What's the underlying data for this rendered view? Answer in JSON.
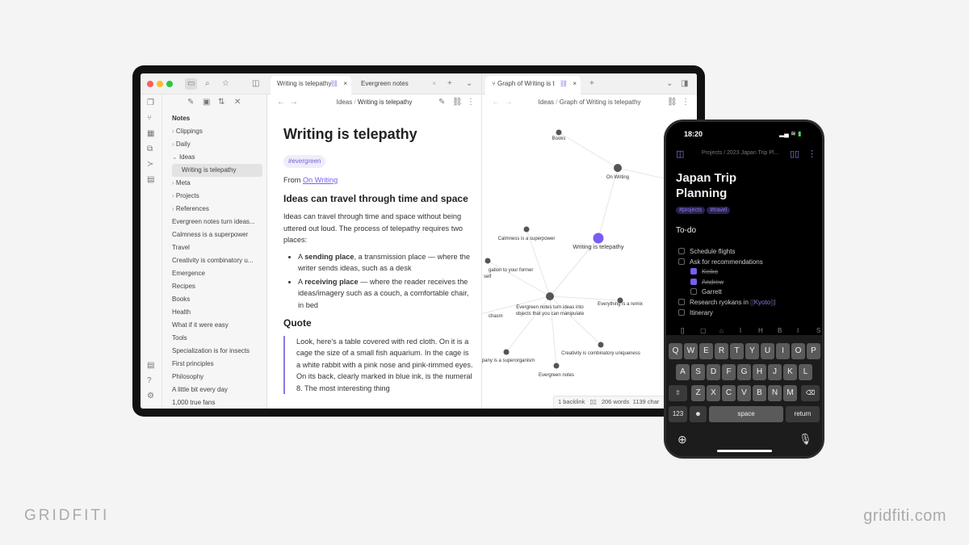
{
  "colors": {
    "accent": "#7a5cf0",
    "background": "#f4f4f4"
  },
  "app": {
    "left_tabs": [
      {
        "label": "Writing is telepathy",
        "active": true
      },
      {
        "label": "Evergreen notes",
        "active": false
      }
    ],
    "right_tabs": [
      {
        "label": "Graph of Writing is t",
        "active": true
      }
    ],
    "ribbon_icons": [
      "files-icon",
      "graph-icon",
      "calendar-icon",
      "copy-icon",
      "terminal-icon",
      "canvas-icon",
      "help-doc-icon",
      "help-icon",
      "settings-icon"
    ],
    "explorer": {
      "header": "Notes",
      "folders": [
        {
          "label": "Clippings",
          "open": false
        },
        {
          "label": "Daily",
          "open": false
        },
        {
          "label": "Ideas",
          "open": true
        }
      ],
      "selected": "Writing is telepathy",
      "more_folders": [
        "Meta",
        "Projects",
        "References"
      ],
      "files": [
        "Evergreen notes turn ideas...",
        "Calmness is a superpower",
        "Travel",
        "Creativity is combinatory u...",
        "Emergence",
        "Recipes",
        "Books",
        "Health",
        "What if it were easy",
        "Tools",
        "Specialization is for insects",
        "First principles",
        "Philosophy",
        "A little bit every day",
        "1,000 true fans"
      ]
    },
    "editor": {
      "breadcrumb": {
        "folder": "Ideas",
        "sep": "/",
        "note": "Writing is telepathy"
      },
      "title": "Writing is telepathy",
      "tag": "#evergreen",
      "from_label": "From ",
      "from_link": "On Writing",
      "h2": "Ideas can travel through time and space",
      "para": "Ideas can travel through time and space without being uttered out loud. The process of telepathy requires two places:",
      "bullets": [
        {
          "pre": "A ",
          "bold": "sending place",
          "post": ", a transmission place — where the writer sends ideas, such as a desk"
        },
        {
          "pre": "A ",
          "bold": "receiving place",
          "post": " — where the reader receives the ideas/imagery such as a couch, a comfortable chair, in bed"
        }
      ],
      "quote_heading": "Quote",
      "quote": "Look, here's a table covered with red cloth. On it is a cage the size of a small fish aquarium. In the cage is a white rabbit with a pink nose and pink-rimmed eyes. On its back, clearly marked in blue ink, is the numeral 8. The most interesting thing"
    },
    "graph": {
      "breadcrumb": {
        "folder": "Ideas",
        "sep": "/",
        "note": "Graph of Writing is telepathy"
      },
      "nodes": [
        "Books",
        "On Writing",
        "Writing is telepathy",
        "Calmness is a superpower",
        "gation to your former self",
        "Evergreen notes turn ideas into objects that you can manipulate",
        "Everything is a remix",
        "chasm",
        "Creativity is combinatory uniqueness",
        "mpany is a superorganism",
        "Evergreen notes"
      ]
    },
    "status": {
      "backlinks": "1 backlink",
      "words": "206 words",
      "chars": "1139 char"
    }
  },
  "phone": {
    "time": "18:20",
    "breadcrumb": "Projects / 2023 Japan Trip Pl...",
    "title_line1": "Japan Trip",
    "title_line2": "Planning",
    "tags": [
      "#projects",
      "#travel"
    ],
    "heading": "To-do",
    "todos": [
      {
        "text": "Schedule flights",
        "checked": false,
        "indent": 0
      },
      {
        "text": "Ask for recommendations",
        "checked": false,
        "indent": 0
      },
      {
        "text": "Keiko",
        "checked": true,
        "indent": 1
      },
      {
        "text": "Andrew",
        "checked": true,
        "indent": 1
      },
      {
        "text": "Garrett",
        "checked": false,
        "indent": 1
      },
      {
        "text": "Research ryokans in ",
        "link": "Kyoto",
        "checked": false,
        "indent": 0
      },
      {
        "text": "Itinerary",
        "checked": false,
        "indent": 0
      }
    ],
    "toolbar": [
      "[]",
      "▢",
      "⌂",
      "⌇",
      "H",
      "B",
      "I",
      "S"
    ],
    "keyboard": {
      "row1": [
        "Q",
        "W",
        "E",
        "R",
        "T",
        "Y",
        "U",
        "I",
        "O",
        "P"
      ],
      "row2": [
        "A",
        "S",
        "D",
        "F",
        "G",
        "H",
        "J",
        "K",
        "L"
      ],
      "row3": [
        "Z",
        "X",
        "C",
        "V",
        "B",
        "N",
        "M"
      ],
      "num": "123",
      "space": "space",
      "return": "return"
    }
  },
  "branding": {
    "left": "GRIDFITI",
    "right": "gridfiti.com"
  }
}
